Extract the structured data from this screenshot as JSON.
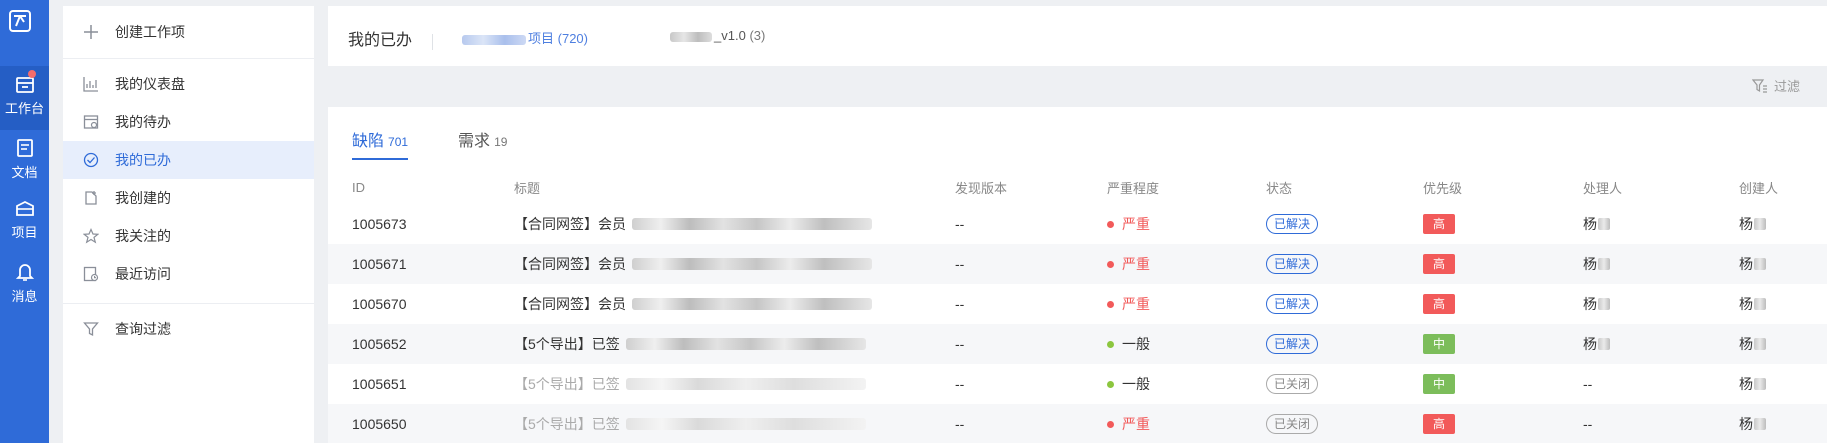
{
  "rail": {
    "items": [
      {
        "label": "工作台",
        "icon": "workbench-icon"
      },
      {
        "label": "文档",
        "icon": "document-icon"
      },
      {
        "label": "项目",
        "icon": "project-icon"
      },
      {
        "label": "消息",
        "icon": "bell-icon"
      }
    ]
  },
  "sidebar": {
    "create_label": "创建工作项",
    "items": [
      {
        "label": "我的仪表盘",
        "icon": "dashboard-icon"
      },
      {
        "label": "我的待办",
        "icon": "todo-icon"
      },
      {
        "label": "我的已办",
        "icon": "check-circle-icon"
      },
      {
        "label": "我创建的",
        "icon": "created-icon"
      },
      {
        "label": "我关注的",
        "icon": "star-icon"
      },
      {
        "label": "最近访问",
        "icon": "recent-icon"
      }
    ],
    "filter_query_label": "查询过滤"
  },
  "header": {
    "title": "我的已办",
    "projects": [
      {
        "suffix": "项目",
        "count": "(720)"
      },
      {
        "suffix": "_v1.0",
        "count": "(3)"
      }
    ]
  },
  "filter_label": "过滤",
  "tabs": [
    {
      "label": "缺陷",
      "count": "701"
    },
    {
      "label": "需求",
      "count": "19"
    }
  ],
  "table": {
    "columns": [
      "ID",
      "标题",
      "发现版本",
      "严重程度",
      "状态",
      "优先级",
      "处理人",
      "创建人"
    ],
    "rows": [
      {
        "id": "1005673",
        "title": "【合同网签】会员",
        "version": "--",
        "severity": "严重",
        "status": "已解决",
        "priority": "高",
        "handler": "杨",
        "creator": "杨"
      },
      {
        "id": "1005671",
        "title": "【合同网签】会员",
        "version": "--",
        "severity": "严重",
        "status": "已解决",
        "priority": "高",
        "handler": "杨",
        "creator": "杨"
      },
      {
        "id": "1005670",
        "title": "【合同网签】会员",
        "version": "--",
        "severity": "严重",
        "status": "已解决",
        "priority": "高",
        "handler": "杨",
        "creator": "杨"
      },
      {
        "id": "1005652",
        "title": "【5个导出】已签",
        "version": "--",
        "severity": "一般",
        "status": "已解决",
        "priority": "中",
        "handler": "杨",
        "creator": "杨"
      },
      {
        "id": "1005651",
        "title": "【5个导出】已签",
        "version": "--",
        "severity": "一般",
        "status": "已关闭",
        "priority": "中",
        "handler": "--",
        "creator": "杨"
      },
      {
        "id": "1005650",
        "title": "【5个导出】已签",
        "version": "--",
        "severity": "严重",
        "status": "已关闭",
        "priority": "高",
        "handler": "--",
        "creator": "杨"
      }
    ]
  },
  "colors": {
    "brand": "#2f6bd8",
    "severe": "#f25a5a",
    "normal_dot": "#8cc63f",
    "priority_high": "#f25a5a",
    "priority_mid": "#7cbd5b"
  }
}
